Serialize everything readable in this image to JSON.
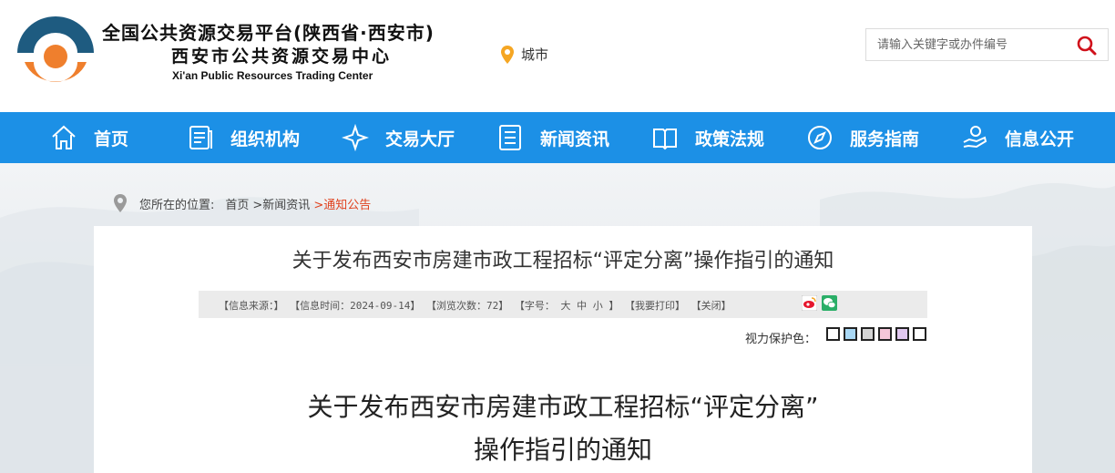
{
  "header": {
    "title_line1": "全国公共资源交易平台(陕西省·西安市)",
    "title_line2": "西安市公共资源交易中心",
    "title_en": "Xi'an Public Resources Trading Center",
    "city_label": "城市",
    "search_placeholder": "请输入关键字或办件编号",
    "logo_colors": {
      "teal": "#1e5b80",
      "orange": "#ef7f2d"
    }
  },
  "nav": {
    "bg_color": "#1c90e6",
    "items": [
      {
        "label": "首页",
        "icon": "home-icon"
      },
      {
        "label": "组织机构",
        "icon": "document-icon"
      },
      {
        "label": "交易大厅",
        "icon": "sparkle-icon"
      },
      {
        "label": "新闻资讯",
        "icon": "list-icon"
      },
      {
        "label": "政策法规",
        "icon": "book-icon"
      },
      {
        "label": "服务指南",
        "icon": "compass-icon"
      },
      {
        "label": "信息公开",
        "icon": "hand-icon"
      }
    ]
  },
  "breadcrumb": {
    "prefix": "您所在的位置:",
    "items": [
      "首页",
      ">新闻资讯",
      ">通知公告"
    ],
    "current_color": "#e0421e"
  },
  "article": {
    "title": "关于发布西安市房建市政工程招标“评定分离”操作指引的通知",
    "meta": {
      "source": "【信息来源：】",
      "time": "【信息时间：2024-09-14】",
      "views": "【浏览次数：72】",
      "font_size_label": "【字号：",
      "font_big": "大",
      "font_mid": "中",
      "font_small": "小",
      "font_end": "】",
      "print": "【我要打印】",
      "close": "【关闭】"
    },
    "eye_protect_label": "视力保护色：",
    "eye_colors": [
      "#ffffff",
      "#a9d8f5",
      "#d4d4d4",
      "#f5c6d8",
      "#e1c8f0",
      "#ffffff"
    ],
    "body_title_line1": "关于发布西安市房建市政工程招标“评定分离”",
    "body_title_line2": "操作指引的通知"
  }
}
